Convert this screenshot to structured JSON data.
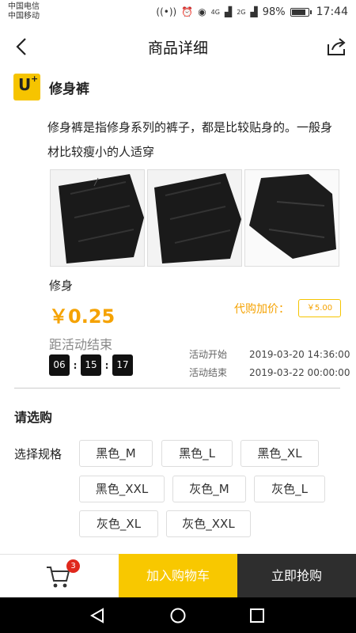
{
  "status_bar": {
    "carrier1": "中国电信",
    "carrier2": "中国移动",
    "signal1": "4G",
    "signal2": "2G",
    "battery": "98%",
    "time": "17:44"
  },
  "header": {
    "title": "商品详细"
  },
  "product": {
    "logo_text": "U",
    "name": "修身裤",
    "description": "修身裤是指修身系列的裤子，都是比较贴身的。一般身材比较瘦小的人适穿",
    "tag": "修身",
    "price": "￥0.25",
    "proxy_label": "代购加价：",
    "proxy_fee": "￥5.00"
  },
  "countdown": {
    "label": "距活动结束",
    "hours": "06",
    "minutes": "15",
    "seconds": "17",
    "start_label": "活动开始",
    "start_time": "2019-03-20 14:36:00",
    "end_label": "活动结束",
    "end_time": "2019-03-22 00:00:00"
  },
  "purchase": {
    "heading": "请选购",
    "spec_label": "选择规格",
    "options": [
      "黑色_M",
      "黑色_L",
      "黑色_XL",
      "黑色_XXL",
      "灰色_M",
      "灰色_L",
      "灰色_XL",
      "灰色_XXL"
    ]
  },
  "bottom": {
    "cart_count": "3",
    "add_to_cart": "加入购物车",
    "buy_now": "立即抢购"
  }
}
